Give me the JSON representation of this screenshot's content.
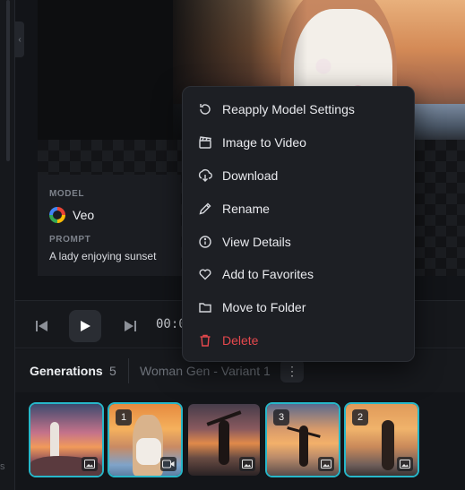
{
  "preview": {
    "model_label": "MODEL",
    "model_name": "Veo",
    "prompt_label": "PROMPT",
    "prompt_text": "A lady enjoying sunset"
  },
  "transport": {
    "timecode": "00:0"
  },
  "generations": {
    "title": "Generations",
    "count": "5",
    "variant": "Woman Gen - Variant 1",
    "more_icon": "⋮",
    "thumbnails": [
      {
        "badge": "",
        "kind": "image-icon",
        "selected": true
      },
      {
        "badge": "1",
        "kind": "video-icon",
        "selected": true
      },
      {
        "badge": "",
        "kind": "image-icon",
        "selected": false
      },
      {
        "badge": "3",
        "kind": "image-icon",
        "selected": true
      },
      {
        "badge": "2",
        "kind": "image-icon",
        "selected": true
      }
    ]
  },
  "context_menu": {
    "items": [
      {
        "label": "Reapply Model Settings",
        "icon": "refresh-icon"
      },
      {
        "label": "Image to Video",
        "icon": "clapper-icon"
      },
      {
        "label": "Download",
        "icon": "download-icon"
      },
      {
        "label": "Rename",
        "icon": "pencil-icon"
      },
      {
        "label": "View Details",
        "icon": "info-icon"
      },
      {
        "label": "Add to Favorites",
        "icon": "heart-icon"
      },
      {
        "label": "Move to Folder",
        "icon": "folder-icon"
      },
      {
        "label": "Delete",
        "icon": "trash-icon"
      }
    ]
  },
  "colors": {
    "accent": "#27b7c9",
    "danger": "#e5484d",
    "menu_bg": "#1d1f24"
  }
}
